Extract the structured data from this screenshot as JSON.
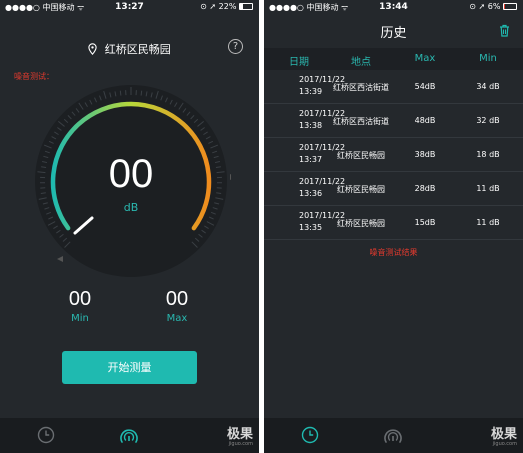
{
  "left": {
    "status": {
      "signal": "●●●●○ 中国移动 ᯤ",
      "time": "13:27",
      "battery": "⊙ ➚ 22%",
      "battery_level": 0.22
    },
    "location": "红桥区民畅园",
    "help_icon": "?",
    "noise_label": "噪音测试：",
    "reading": {
      "value": "00",
      "unit": "dB"
    },
    "stats": {
      "min_value": "00",
      "min_label": "Min",
      "max_value": "00",
      "max_label": "Max"
    },
    "start_button": "开始测量",
    "tabs": {
      "history": "clock-icon",
      "measure": "gauge-icon"
    },
    "watermark": "极果",
    "watermark_url": "jiguo.com"
  },
  "right": {
    "status": {
      "signal": "●●●●○ 中国移动 ᯤ",
      "time": "13:44",
      "battery": "⊙ ➚ 6%",
      "battery_level": 0.06
    },
    "title": "历史",
    "columns": {
      "date": "日期",
      "place": "地点",
      "max": "Max",
      "min": "Min"
    },
    "rows": [
      {
        "date": "2017/11/22",
        "time": "13:39",
        "place": "红桥区西沽街道",
        "max": "54dB",
        "min": "34 dB"
      },
      {
        "date": "2017/11/22",
        "time": "13:38",
        "place": "红桥区西沽街道",
        "max": "48dB",
        "min": "32 dB"
      },
      {
        "date": "2017/11/22",
        "time": "13:37",
        "place": "红桥区民畅园",
        "max": "38dB",
        "min": "18 dB"
      },
      {
        "date": "2017/11/22",
        "time": "13:36",
        "place": "红桥区民畅园",
        "max": "28dB",
        "min": "11 dB"
      },
      {
        "date": "2017/11/22",
        "time": "13:35",
        "place": "红桥区民畅园",
        "max": "15dB",
        "min": "11 dB"
      }
    ],
    "result_label": "噪音测试结果",
    "watermark": "极果",
    "watermark_url": "jiguo.com"
  },
  "colors": {
    "accent": "#1fbab0",
    "background": "#24282c",
    "warning": "#e23a2e",
    "gauge_start": "#1fbab0",
    "gauge_mid": "#b8d83a",
    "gauge_end": "#f08c1e"
  }
}
